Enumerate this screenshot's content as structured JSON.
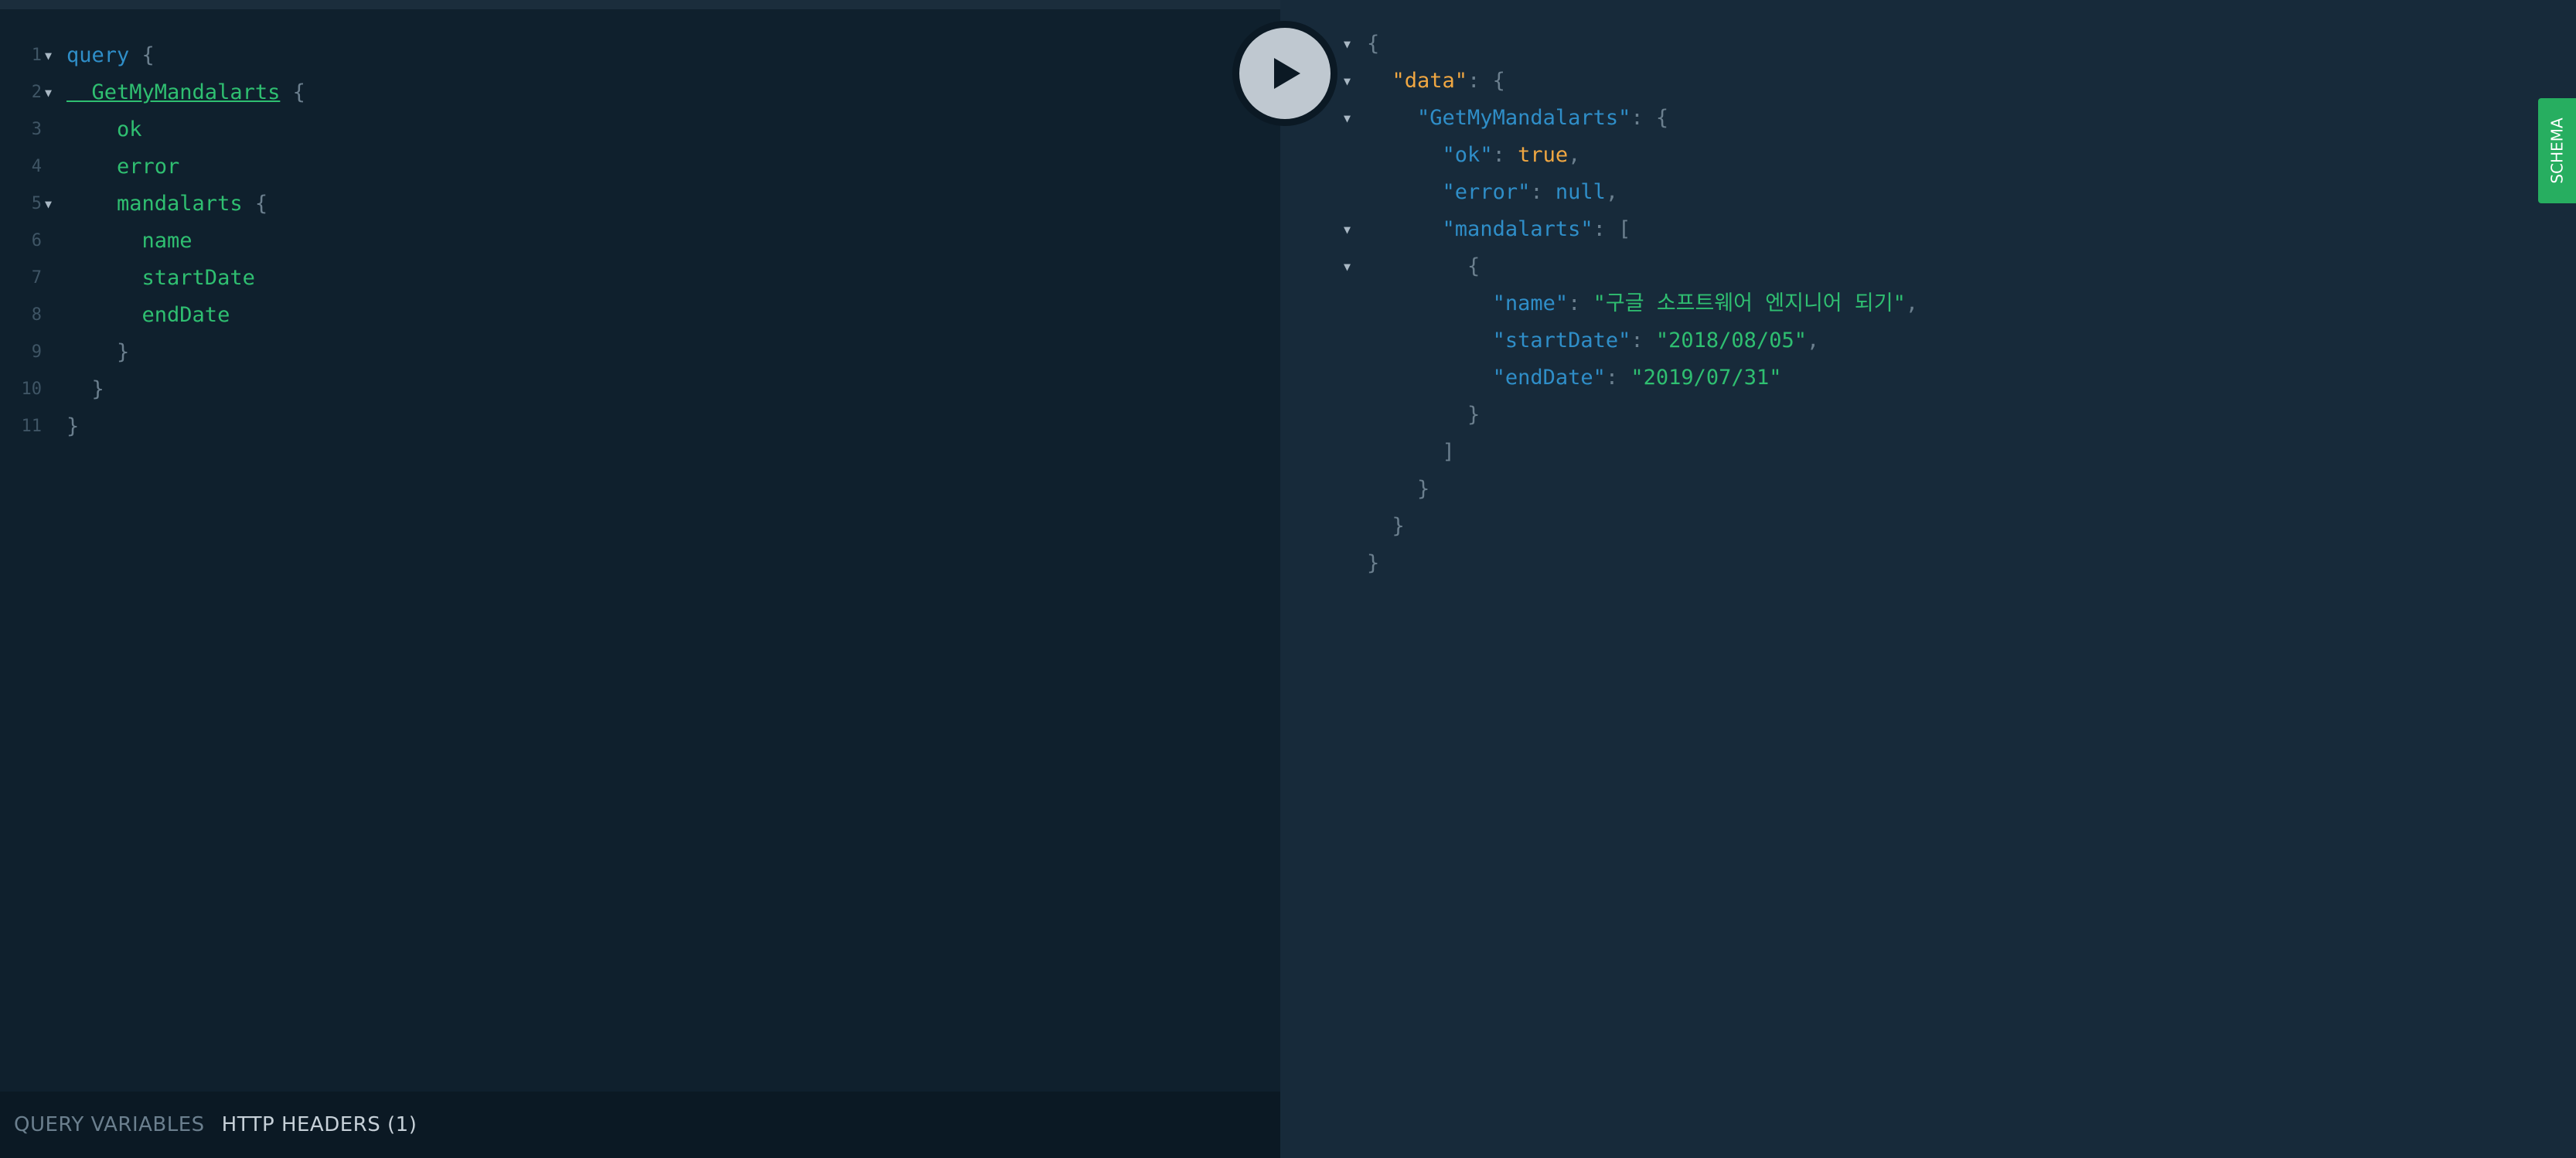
{
  "editor": {
    "lines": [
      {
        "num": "1",
        "fold": true,
        "parts": [
          [
            "kw",
            "query"
          ],
          [
            "punc",
            " {"
          ]
        ]
      },
      {
        "num": "2",
        "fold": true,
        "parts": [
          [
            "op-name",
            "  GetMyMandalarts"
          ],
          [
            "punc",
            " {"
          ]
        ]
      },
      {
        "num": "3",
        "fold": false,
        "parts": [
          [
            "fld",
            "    ok"
          ]
        ]
      },
      {
        "num": "4",
        "fold": false,
        "parts": [
          [
            "fld",
            "    error"
          ]
        ]
      },
      {
        "num": "5",
        "fold": true,
        "parts": [
          [
            "fld",
            "    mandalarts"
          ],
          [
            "punc",
            " {"
          ]
        ]
      },
      {
        "num": "6",
        "fold": false,
        "parts": [
          [
            "fld",
            "      name"
          ]
        ]
      },
      {
        "num": "7",
        "fold": false,
        "parts": [
          [
            "fld",
            "      startDate"
          ]
        ]
      },
      {
        "num": "8",
        "fold": false,
        "parts": [
          [
            "fld",
            "      endDate"
          ]
        ]
      },
      {
        "num": "9",
        "fold": false,
        "parts": [
          [
            "punc",
            "    }"
          ]
        ]
      },
      {
        "num": "10",
        "fold": false,
        "parts": [
          [
            "punc",
            "  }"
          ]
        ]
      },
      {
        "num": "11",
        "fold": false,
        "parts": [
          [
            "punc",
            "}"
          ]
        ]
      }
    ]
  },
  "results": {
    "lines": [
      {
        "fold": true,
        "parts": [
          [
            "p",
            "{"
          ]
        ]
      },
      {
        "fold": true,
        "parts": [
          [
            "p",
            "  "
          ],
          [
            "kdata",
            "\"data\""
          ],
          [
            "p",
            ": {"
          ]
        ]
      },
      {
        "fold": true,
        "parts": [
          [
            "p",
            "    "
          ],
          [
            "k",
            "\"GetMyMandalarts\""
          ],
          [
            "p",
            ": {"
          ]
        ]
      },
      {
        "fold": false,
        "parts": [
          [
            "p",
            "      "
          ],
          [
            "k",
            "\"ok\""
          ],
          [
            "p",
            ": "
          ],
          [
            "b",
            "true"
          ],
          [
            "p",
            ","
          ]
        ]
      },
      {
        "fold": false,
        "parts": [
          [
            "p",
            "      "
          ],
          [
            "k",
            "\"error\""
          ],
          [
            "p",
            ": "
          ],
          [
            "n",
            "null"
          ],
          [
            "p",
            ","
          ]
        ]
      },
      {
        "fold": true,
        "parts": [
          [
            "p",
            "      "
          ],
          [
            "k",
            "\"mandalarts\""
          ],
          [
            "p",
            ": ["
          ]
        ]
      },
      {
        "fold": true,
        "parts": [
          [
            "p",
            "        {"
          ]
        ]
      },
      {
        "fold": false,
        "parts": [
          [
            "p",
            "          "
          ],
          [
            "k",
            "\"name\""
          ],
          [
            "p",
            ": "
          ],
          [
            "s",
            "\"구글 소프트웨어 엔지니어 되기\""
          ],
          [
            "p",
            ","
          ]
        ]
      },
      {
        "fold": false,
        "parts": [
          [
            "p",
            "          "
          ],
          [
            "k",
            "\"startDate\""
          ],
          [
            "p",
            ": "
          ],
          [
            "s",
            "\"2018/08/05\""
          ],
          [
            "p",
            ","
          ]
        ]
      },
      {
        "fold": false,
        "parts": [
          [
            "p",
            "          "
          ],
          [
            "k",
            "\"endDate\""
          ],
          [
            "p",
            ": "
          ],
          [
            "s",
            "\"2019/07/31\""
          ]
        ]
      },
      {
        "fold": false,
        "parts": [
          [
            "p",
            "        }"
          ]
        ]
      },
      {
        "fold": false,
        "parts": [
          [
            "p",
            "      ]"
          ]
        ]
      },
      {
        "fold": false,
        "parts": [
          [
            "p",
            "    }"
          ]
        ]
      },
      {
        "fold": false,
        "parts": [
          [
            "p",
            "  }"
          ]
        ]
      },
      {
        "fold": false,
        "parts": [
          [
            "p",
            "}"
          ]
        ]
      }
    ]
  },
  "bottom": {
    "query_variables": "QUERY VARIABLES",
    "http_headers": "HTTP HEADERS (1)"
  },
  "schema_label": "SCHEMA",
  "icons": {
    "play": "play-icon",
    "fold": "chevron-down-icon"
  }
}
